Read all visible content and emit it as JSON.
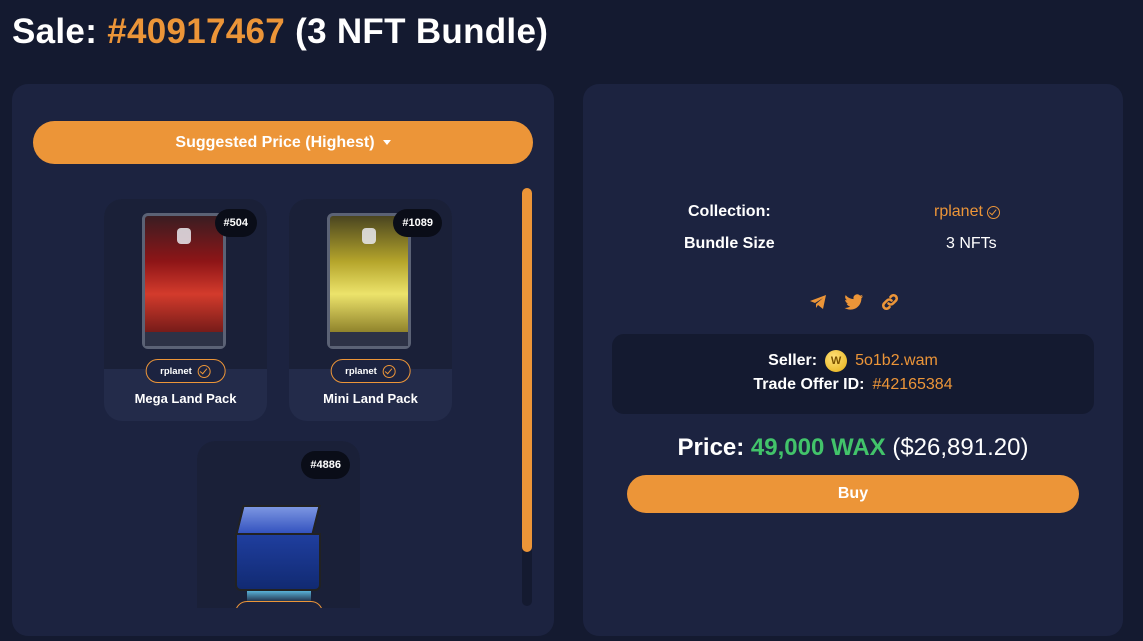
{
  "page_title": {
    "prefix": "Sale:",
    "sale_id": "#40917467",
    "suffix": "(3 NFT Bundle)"
  },
  "sort": {
    "label": "Suggested Price (Highest)"
  },
  "cards": [
    {
      "badge": "#504",
      "collection": "rplanet",
      "name": "Mega Land Pack"
    },
    {
      "badge": "#1089",
      "collection": "rplanet",
      "name": "Mini Land Pack"
    },
    {
      "badge": "#4886",
      "collection": "",
      "name": ""
    }
  ],
  "details": {
    "collection_label": "Collection:",
    "collection_value": "rplanet",
    "bundle_label": "Bundle Size",
    "bundle_value": "3 NFTs"
  },
  "share_icons": [
    "telegram-icon",
    "twitter-icon",
    "link-icon"
  ],
  "seller": {
    "label": "Seller:",
    "coin_letter": "W",
    "name": "5o1b2.wam",
    "trade_label": "Trade Offer ID:",
    "trade_id": "#42165384"
  },
  "price": {
    "label": "Price:",
    "amount": "49,000 WAX",
    "usd": "($26,891.20)"
  },
  "buy": {
    "label": "Buy"
  },
  "colors": {
    "accent": "#ec9538",
    "price_green": "#42c36a",
    "background": "#141a30",
    "panel": "#1c2340"
  }
}
